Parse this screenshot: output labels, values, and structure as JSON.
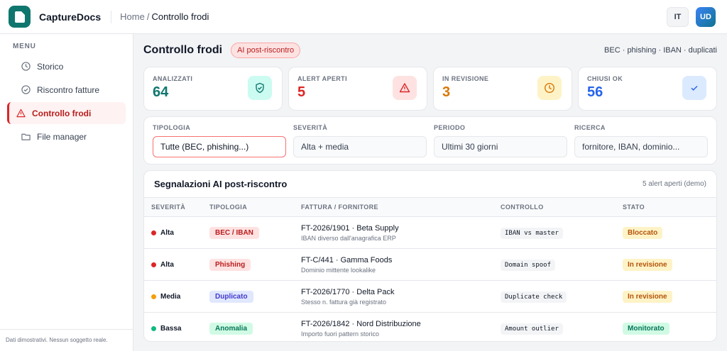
{
  "app": {
    "name": "CaptureDocs",
    "lang": "IT",
    "user_initials": "UD"
  },
  "breadcrumb": {
    "home": "Home",
    "separator": "/",
    "current": "Controllo frodi"
  },
  "sidebar": {
    "menu_label": "MENU",
    "items": [
      {
        "label": "Storico",
        "icon": "clock-icon"
      },
      {
        "label": "Riscontro fatture",
        "icon": "check-circle-icon"
      },
      {
        "label": "Controllo frodi",
        "icon": "warning-icon",
        "active": true
      },
      {
        "label": "File manager",
        "icon": "folder-icon"
      }
    ],
    "footer": "Dati dimostrativi. Nessun soggetto reale."
  },
  "page": {
    "title": "Controllo frodi",
    "badge": "AI post-riscontro",
    "topics": "BEC · phishing · IBAN · duplicati"
  },
  "stats": [
    {
      "label": "ANALIZZATI",
      "value": "64",
      "color": "#0f766e",
      "icon": "shield-check-icon"
    },
    {
      "label": "ALERT APERTI",
      "value": "5",
      "color": "#dc2626",
      "icon": "warning-icon"
    },
    {
      "label": "IN REVISIONE",
      "value": "3",
      "color": "#d97706",
      "icon": "clock-icon"
    },
    {
      "label": "CHIUSI OK",
      "value": "56",
      "color": "#2563eb",
      "icon": "check-icon"
    }
  ],
  "filters": [
    {
      "label": "TIPOLOGIA",
      "value": "Tutte (BEC, phishing...)"
    },
    {
      "label": "SEVERITÀ",
      "value": "Alta + media"
    },
    {
      "label": "PERIODO",
      "value": "Ultimi 30 giorni"
    },
    {
      "label": "RICERCA",
      "placeholder": "fornitore, IBAN, dominio..."
    }
  ],
  "table": {
    "title": "Segnalazioni AI post-riscontro",
    "count": "5 alert aperti (demo)",
    "headers": [
      "SEVERITÀ",
      "TIPOLOGIA",
      "FATTURA / FORNITORE",
      "CONTROLLO",
      "STATO"
    ],
    "rows": [
      {
        "severity": "Alta",
        "sev_color": "#dc2626",
        "type": "BEC / IBAN",
        "type_bg": "#fee2e2",
        "type_fg": "#b91c1c",
        "invoice": "FT-2026/1901 · Beta Supply",
        "note": "IBAN diverso dall'anagrafica ERP",
        "check": "IBAN vs master",
        "status": "Bloccato",
        "status_bg": "#fef3c7",
        "status_fg": "#b45309"
      },
      {
        "severity": "Alta",
        "sev_color": "#dc2626",
        "type": "Phishing",
        "type_bg": "#fee2e2",
        "type_fg": "#b91c1c",
        "invoice": "FT-C/441 · Gamma Foods",
        "note": "Dominio mittente lookalike",
        "check": "Domain spoof",
        "status": "In revisione",
        "status_bg": "#fef3c7",
        "status_fg": "#b45309"
      },
      {
        "severity": "Media",
        "sev_color": "#f59e0b",
        "type": "Duplicato",
        "type_bg": "#e0e7ff",
        "type_fg": "#4338ca",
        "invoice": "FT-2026/1770 · Delta Pack",
        "note": "Stesso n. fattura già registrato",
        "check": "Duplicate check",
        "status": "In revisione",
        "status_bg": "#fef3c7",
        "status_fg": "#b45309"
      },
      {
        "severity": "Bassa",
        "sev_color": "#10b981",
        "type": "Anomalia",
        "type_bg": "#d1fae5",
        "type_fg": "#047857",
        "invoice": "FT-2026/1842 · Nord Distribuzione",
        "note": "Importo fuori pattern storico",
        "check": "Amount outlier",
        "status": "Monitorato",
        "status_bg": "#d1fae5",
        "status_fg": "#047857"
      }
    ]
  }
}
